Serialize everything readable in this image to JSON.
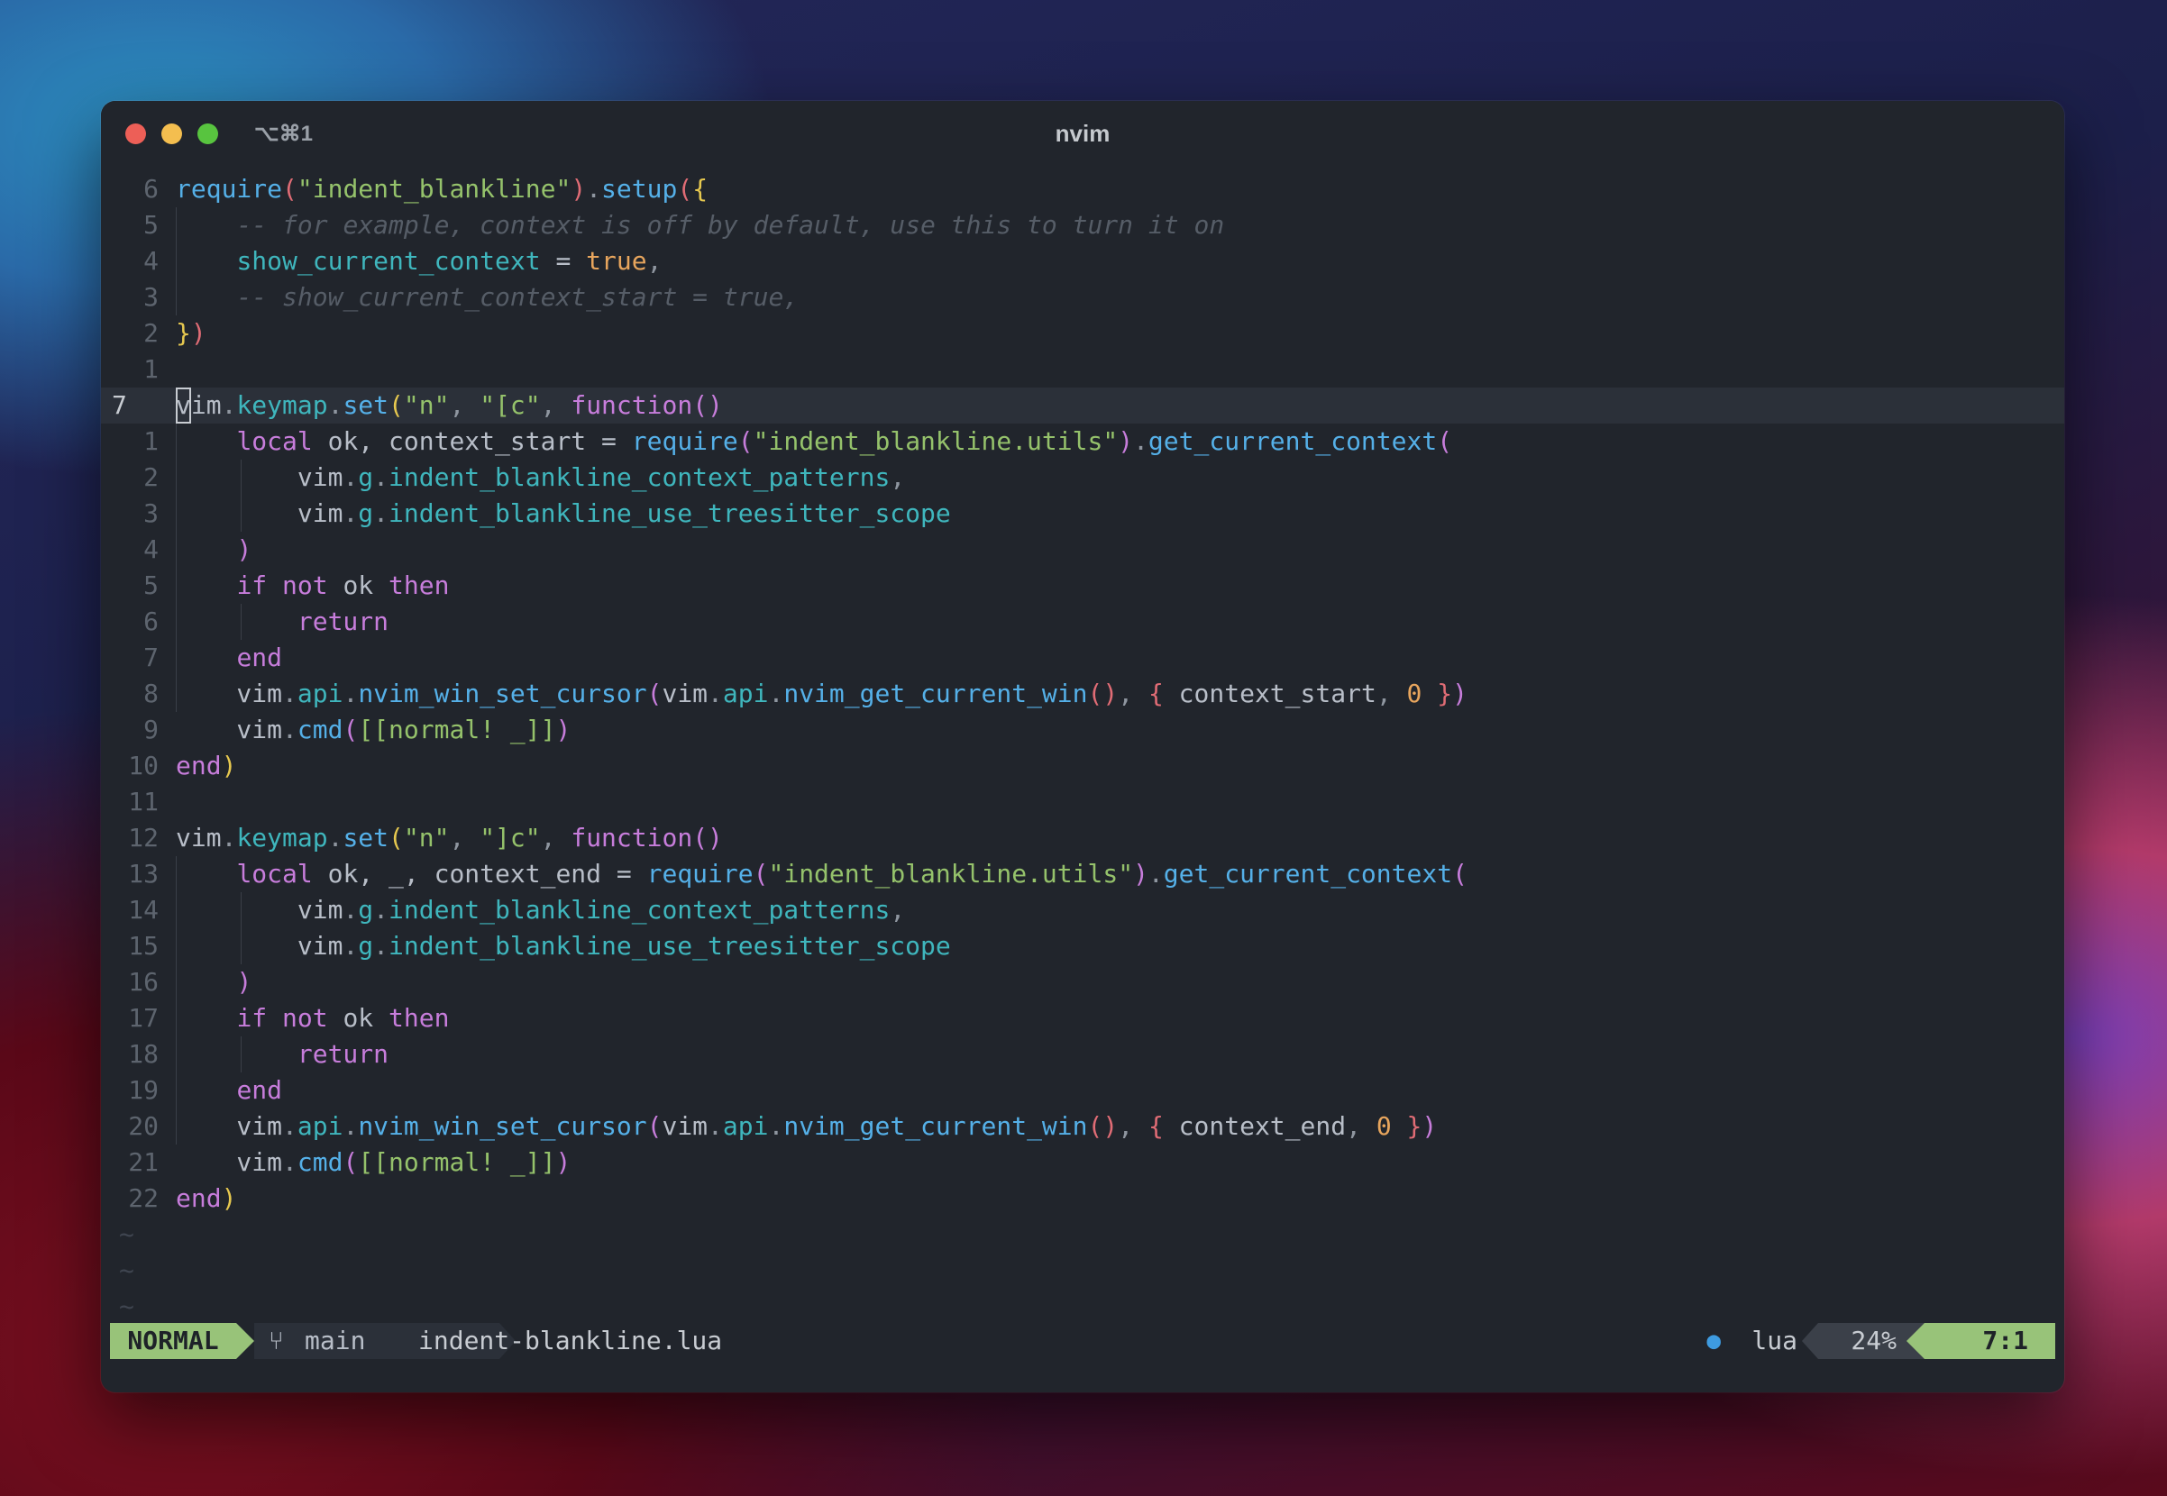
{
  "window": {
    "title": "nvim",
    "shortcut": "⌥⌘1"
  },
  "editor": {
    "lines": [
      {
        "num": "6",
        "tokens": [
          [
            "fn",
            "require"
          ],
          [
            "p3",
            "("
          ],
          [
            "str",
            "\"indent_blankline\""
          ],
          [
            "p3",
            ")"
          ],
          [
            "op",
            "."
          ],
          [
            "fn",
            "setup"
          ],
          [
            "p3",
            "("
          ],
          [
            "p1",
            "{"
          ]
        ]
      },
      {
        "num": "5",
        "tokens": [
          [
            "",
            "    "
          ],
          [
            "cm",
            "-- for example, context is off by default, use this to turn it on"
          ]
        ]
      },
      {
        "num": "4",
        "tokens": [
          [
            "",
            "    "
          ],
          [
            "fld",
            "show_current_context"
          ],
          [
            "",
            " = "
          ],
          [
            "bool",
            "true"
          ],
          [
            "op",
            ","
          ]
        ]
      },
      {
        "num": "3",
        "tokens": [
          [
            "",
            "    "
          ],
          [
            "cm",
            "-- show_current_context_start = true,"
          ]
        ]
      },
      {
        "num": "2",
        "tokens": [
          [
            "p1",
            "}"
          ],
          [
            "p3",
            ")"
          ]
        ]
      },
      {
        "num": "1",
        "tokens": []
      },
      {
        "num": "7",
        "current": true,
        "tokens": [
          [
            "cursor",
            "v"
          ],
          [
            "",
            "im"
          ],
          [
            "op",
            "."
          ],
          [
            "fld",
            "keymap"
          ],
          [
            "op",
            "."
          ],
          [
            "fn",
            "set"
          ],
          [
            "p1",
            "("
          ],
          [
            "str",
            "\"n\""
          ],
          [
            "op",
            ", "
          ],
          [
            "str",
            "\"[c\""
          ],
          [
            "op",
            ", "
          ],
          [
            "kw",
            "function"
          ],
          [
            "p2",
            "()"
          ]
        ]
      },
      {
        "num": "1",
        "tokens": [
          [
            "",
            "    "
          ],
          [
            "kw",
            "local"
          ],
          [
            "",
            " ok, context_start = "
          ],
          [
            "fn",
            "require"
          ],
          [
            "p2",
            "("
          ],
          [
            "str",
            "\"indent_blankline.utils\""
          ],
          [
            "p2",
            ")"
          ],
          [
            "op",
            "."
          ],
          [
            "fn",
            "get_current_context"
          ],
          [
            "p2",
            "("
          ]
        ]
      },
      {
        "num": "2",
        "tokens": [
          [
            "",
            "        vim"
          ],
          [
            "op",
            "."
          ],
          [
            "fld",
            "g"
          ],
          [
            "op",
            "."
          ],
          [
            "fld",
            "indent_blankline_context_patterns"
          ],
          [
            "op",
            ","
          ]
        ]
      },
      {
        "num": "3",
        "tokens": [
          [
            "",
            "        vim"
          ],
          [
            "op",
            "."
          ],
          [
            "fld",
            "g"
          ],
          [
            "op",
            "."
          ],
          [
            "fld",
            "indent_blankline_use_treesitter_scope"
          ]
        ]
      },
      {
        "num": "4",
        "tokens": [
          [
            "",
            "    "
          ],
          [
            "p2",
            ")"
          ]
        ]
      },
      {
        "num": "5",
        "tokens": [
          [
            "",
            "    "
          ],
          [
            "kw",
            "if"
          ],
          [
            "",
            " "
          ],
          [
            "kw",
            "not"
          ],
          [
            "",
            " ok "
          ],
          [
            "kw",
            "then"
          ]
        ]
      },
      {
        "num": "6",
        "tokens": [
          [
            "",
            "        "
          ],
          [
            "kw",
            "return"
          ]
        ]
      },
      {
        "num": "7",
        "tokens": [
          [
            "",
            "    "
          ],
          [
            "kw",
            "end"
          ]
        ]
      },
      {
        "num": "8",
        "tokens": [
          [
            "",
            "    vim"
          ],
          [
            "op",
            "."
          ],
          [
            "fld",
            "api"
          ],
          [
            "op",
            "."
          ],
          [
            "fn",
            "nvim_win_set_cursor"
          ],
          [
            "p2",
            "("
          ],
          [
            "",
            "vim"
          ],
          [
            "op",
            "."
          ],
          [
            "fld",
            "api"
          ],
          [
            "op",
            "."
          ],
          [
            "fn",
            "nvim_get_current_win"
          ],
          [
            "p3",
            "()"
          ],
          [
            "op",
            ", "
          ],
          [
            "p3",
            "{"
          ],
          [
            "",
            " context_start"
          ],
          [
            "op",
            ", "
          ],
          [
            "num",
            "0"
          ],
          [
            "",
            " "
          ],
          [
            "p3",
            "}"
          ],
          [
            "p2",
            ")"
          ]
        ]
      },
      {
        "num": "9",
        "tokens": [
          [
            "",
            "    vim"
          ],
          [
            "op",
            "."
          ],
          [
            "fn",
            "cmd"
          ],
          [
            "p2",
            "("
          ],
          [
            "str",
            "[[normal! _]]"
          ],
          [
            "p2",
            ")"
          ]
        ]
      },
      {
        "num": "10",
        "tokens": [
          [
            "kw",
            "end"
          ],
          [
            "p1",
            ")"
          ]
        ]
      },
      {
        "num": "11",
        "tokens": []
      },
      {
        "num": "12",
        "tokens": [
          [
            "",
            "vim"
          ],
          [
            "op",
            "."
          ],
          [
            "fld",
            "keymap"
          ],
          [
            "op",
            "."
          ],
          [
            "fn",
            "set"
          ],
          [
            "p1",
            "("
          ],
          [
            "str",
            "\"n\""
          ],
          [
            "op",
            ", "
          ],
          [
            "str",
            "\"]c\""
          ],
          [
            "op",
            ", "
          ],
          [
            "kw",
            "function"
          ],
          [
            "p2",
            "()"
          ]
        ]
      },
      {
        "num": "13",
        "tokens": [
          [
            "",
            "    "
          ],
          [
            "kw",
            "local"
          ],
          [
            "",
            " ok, _, context_end = "
          ],
          [
            "fn",
            "require"
          ],
          [
            "p2",
            "("
          ],
          [
            "str",
            "\"indent_blankline.utils\""
          ],
          [
            "p2",
            ")"
          ],
          [
            "op",
            "."
          ],
          [
            "fn",
            "get_current_context"
          ],
          [
            "p2",
            "("
          ]
        ]
      },
      {
        "num": "14",
        "tokens": [
          [
            "",
            "        vim"
          ],
          [
            "op",
            "."
          ],
          [
            "fld",
            "g"
          ],
          [
            "op",
            "."
          ],
          [
            "fld",
            "indent_blankline_context_patterns"
          ],
          [
            "op",
            ","
          ]
        ]
      },
      {
        "num": "15",
        "tokens": [
          [
            "",
            "        vim"
          ],
          [
            "op",
            "."
          ],
          [
            "fld",
            "g"
          ],
          [
            "op",
            "."
          ],
          [
            "fld",
            "indent_blankline_use_treesitter_scope"
          ]
        ]
      },
      {
        "num": "16",
        "tokens": [
          [
            "",
            "    "
          ],
          [
            "p2",
            ")"
          ]
        ]
      },
      {
        "num": "17",
        "tokens": [
          [
            "",
            "    "
          ],
          [
            "kw",
            "if"
          ],
          [
            "",
            " "
          ],
          [
            "kw",
            "not"
          ],
          [
            "",
            " ok "
          ],
          [
            "kw",
            "then"
          ]
        ]
      },
      {
        "num": "18",
        "tokens": [
          [
            "",
            "        "
          ],
          [
            "kw",
            "return"
          ]
        ]
      },
      {
        "num": "19",
        "tokens": [
          [
            "",
            "    "
          ],
          [
            "kw",
            "end"
          ]
        ]
      },
      {
        "num": "20",
        "tokens": [
          [
            "",
            "    vim"
          ],
          [
            "op",
            "."
          ],
          [
            "fld",
            "api"
          ],
          [
            "op",
            "."
          ],
          [
            "fn",
            "nvim_win_set_cursor"
          ],
          [
            "p2",
            "("
          ],
          [
            "",
            "vim"
          ],
          [
            "op",
            "."
          ],
          [
            "fld",
            "api"
          ],
          [
            "op",
            "."
          ],
          [
            "fn",
            "nvim_get_current_win"
          ],
          [
            "p3",
            "()"
          ],
          [
            "op",
            ", "
          ],
          [
            "p3",
            "{"
          ],
          [
            "",
            " context_end"
          ],
          [
            "op",
            ", "
          ],
          [
            "num",
            "0"
          ],
          [
            "",
            " "
          ],
          [
            "p3",
            "}"
          ],
          [
            "p2",
            ")"
          ]
        ]
      },
      {
        "num": "21",
        "tokens": [
          [
            "",
            "    vim"
          ],
          [
            "op",
            "."
          ],
          [
            "fn",
            "cmd"
          ],
          [
            "p2",
            "("
          ],
          [
            "str",
            "[[normal! _]]"
          ],
          [
            "p2",
            ")"
          ]
        ]
      },
      {
        "num": "22",
        "tokens": [
          [
            "kw",
            "end"
          ],
          [
            "p1",
            ")"
          ]
        ]
      }
    ],
    "filler": [
      "~",
      "~",
      "~"
    ]
  },
  "statusline": {
    "mode": "NORMAL",
    "branch_icon": "branch-icon",
    "branch": "main",
    "filename": "indent-blankline.lua",
    "filetype_icon": "lua-icon",
    "filetype": "lua",
    "percent": "24%",
    "position": "7:1"
  },
  "colors": {
    "mode_bg": "#98c379",
    "editor_bg": "#21252c",
    "function": "#55b0e8",
    "string": "#95c26b",
    "keyword": "#c77ddb",
    "comment": "#565d67"
  }
}
